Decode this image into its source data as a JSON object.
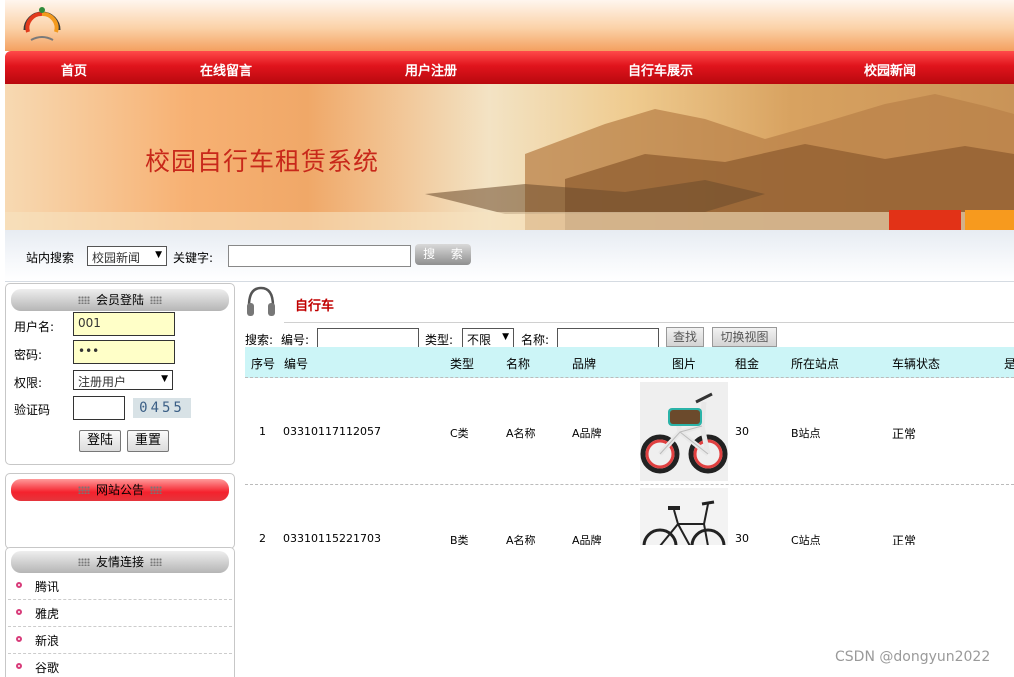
{
  "nav": {
    "items": [
      "首页",
      "在线留言",
      "用户注册",
      "自行车展示",
      "校园新闻"
    ]
  },
  "banner": {
    "title": "校园自行车租赁系统"
  },
  "site_search": {
    "label": "站内搜索",
    "category_selected": "校园新闻",
    "keyword_label": "关键字:",
    "keyword_value": "",
    "search_button": "搜 索"
  },
  "login": {
    "header": "会员登陆",
    "username_label": "用户名:",
    "username_value": "001",
    "password_label": "密码:",
    "password_value": "•••",
    "role_label": "权限:",
    "role_selected": "注册用户",
    "captcha_label": "验证码",
    "captcha_value": "",
    "captcha_code": "0455",
    "login_button": "登陆",
    "reset_button": "重置"
  },
  "announcement": {
    "header": "网站公告"
  },
  "friend_links": {
    "header": "友情连接",
    "items": [
      "腾讯",
      "雅虎",
      "新浪",
      "谷歌"
    ]
  },
  "main": {
    "section_title": "自行车",
    "filter": {
      "prefix": "搜索:",
      "code_label": "编号:",
      "type_label": "类型:",
      "type_selected": "不限",
      "name_label": "名称:",
      "find_button": "查找",
      "toggle_view_button": "切换视图"
    },
    "table": {
      "columns": [
        "序号",
        "编号",
        "类型",
        "名称",
        "品牌",
        "图片",
        "租金",
        "所在站点",
        "车辆状态",
        "是"
      ],
      "rows": [
        {
          "no": "1",
          "code": "03310117112057",
          "type": "C类",
          "name": "A名称",
          "brand": "A品牌",
          "rent": "30",
          "station": "B站点",
          "status": "正常"
        },
        {
          "no": "2",
          "code": "03310115221703",
          "type": "B类",
          "name": "A名称",
          "brand": "A品牌",
          "rent": "30",
          "station": "C站点",
          "status": "正常"
        }
      ]
    }
  },
  "watermark": "CSDN @dongyun2022",
  "colors": {
    "nav_red": "#e0141c",
    "title_red": "#c00000",
    "header_cyan": "#ccf5f7",
    "input_yellow": "#ffffc8"
  }
}
